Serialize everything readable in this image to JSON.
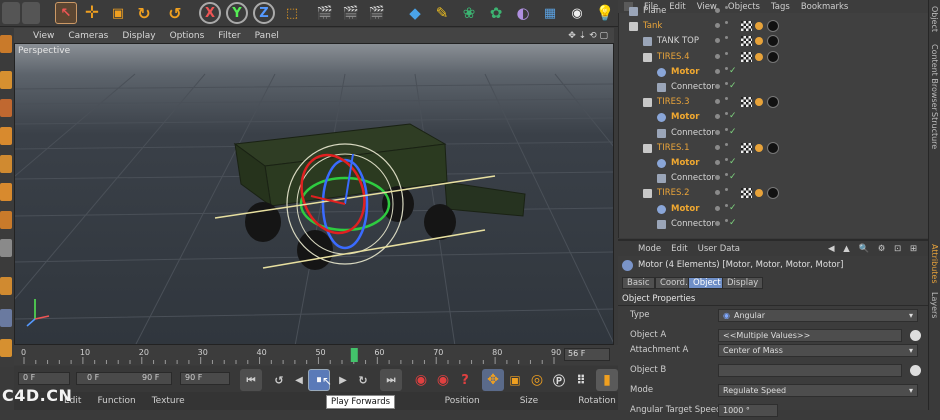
{
  "viewport": {
    "menu": [
      "View",
      "Cameras",
      "Display",
      "Options",
      "Filter",
      "Panel"
    ],
    "label": "Perspective"
  },
  "toolbar": {
    "axis_x": "X",
    "axis_y": "Y",
    "axis_z": "Z"
  },
  "timeline": {
    "ticks": [
      "0",
      "10",
      "20",
      "30",
      "40",
      "50",
      "60",
      "70",
      "80",
      "90"
    ],
    "current_frame_display": "56 F",
    "playhead_frame": 56,
    "max_frame": 90
  },
  "transport": {
    "start_field": "0 F",
    "min_field": "0 F",
    "max_field": "90 F",
    "end_field": "90 F",
    "tooltip": "Play Forwards"
  },
  "bottom_bar": {
    "items": [
      "Edit",
      "Function",
      "Texture"
    ],
    "coords": [
      "Position",
      "Size",
      "Rotation"
    ],
    "watermark": "C4D.CN"
  },
  "object_manager": {
    "menu": [
      "File",
      "Edit",
      "View",
      "Objects",
      "Tags",
      "Bookmarks"
    ],
    "rows": [
      {
        "name": "Plane",
        "indent": 0,
        "style": "normal"
      },
      {
        "name": "Tank",
        "indent": 0,
        "style": "orange"
      },
      {
        "name": "TANK TOP",
        "indent": 1,
        "style": "normal"
      },
      {
        "name": "TIRES.4",
        "indent": 1,
        "style": "orange"
      },
      {
        "name": "Motor",
        "indent": 2,
        "style": "selected"
      },
      {
        "name": "Connector",
        "indent": 2,
        "style": "normal"
      },
      {
        "name": "TIRES.3",
        "indent": 1,
        "style": "orange"
      },
      {
        "name": "Motor",
        "indent": 2,
        "style": "selected"
      },
      {
        "name": "Connector",
        "indent": 2,
        "style": "normal"
      },
      {
        "name": "TIRES.1",
        "indent": 1,
        "style": "orange"
      },
      {
        "name": "Motor",
        "indent": 2,
        "style": "selected"
      },
      {
        "name": "Connector",
        "indent": 2,
        "style": "normal"
      },
      {
        "name": "TIRES.2",
        "indent": 1,
        "style": "orange"
      },
      {
        "name": "Motor",
        "indent": 2,
        "style": "selected"
      },
      {
        "name": "Connector",
        "indent": 2,
        "style": "normal"
      }
    ]
  },
  "side_tabs": {
    "right_top": [
      "Object",
      "Content Browser",
      "Structure"
    ],
    "right_bottom": [
      "Attributes",
      "Layers"
    ]
  },
  "attributes": {
    "menu": [
      "Mode",
      "Edit",
      "User Data"
    ],
    "title": "Motor (4 Elements) [Motor, Motor, Motor, Motor]",
    "tabs": [
      "Basic",
      "Coord.",
      "Object",
      "Display"
    ],
    "active_tab": "Object",
    "section": "Object Properties",
    "fields": [
      {
        "label": "Type",
        "value": "Angular"
      },
      {
        "label": "Object A",
        "value": "<<Multiple Values>>"
      },
      {
        "label": "Attachment A",
        "value": "Center of Mass"
      },
      {
        "label": "Object B",
        "value": ""
      },
      {
        "label": "Mode",
        "value": "Regulate Speed"
      },
      {
        "label": "Angular Target Speed",
        "value": "1000 °"
      }
    ]
  },
  "colors": {
    "accent_orange": "#e8a33a",
    "selected_blue": "#6f8fc7",
    "playhead_green": "#43c36b",
    "record_red": "#c0392b"
  }
}
